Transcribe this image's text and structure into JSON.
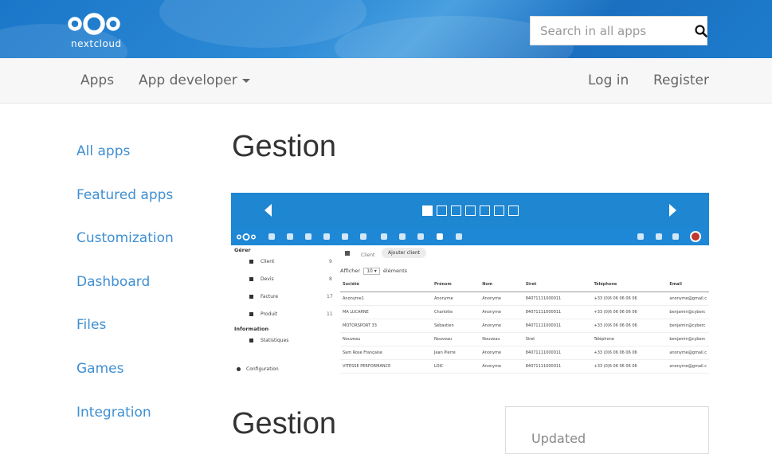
{
  "header": {
    "logo_text": "Nextcloud",
    "search_placeholder": "Search in all apps"
  },
  "nav": {
    "apps": "Apps",
    "app_developer": "App developer",
    "login": "Log in",
    "register": "Register"
  },
  "sidebar": {
    "items": [
      {
        "label": "All apps"
      },
      {
        "label": "Featured apps"
      },
      {
        "label": "Customization"
      },
      {
        "label": "Dashboard"
      },
      {
        "label": "Files"
      },
      {
        "label": "Games"
      },
      {
        "label": "Integration"
      }
    ]
  },
  "main": {
    "title": "Gestion",
    "title_secondary": "Gestion",
    "panel_text": "Updated"
  },
  "carousel": {
    "dot_count": 7,
    "active_index": 0
  },
  "screenshot": {
    "left": {
      "section_manage": "Gérer",
      "items": [
        {
          "label": "Client",
          "count": "9"
        },
        {
          "label": "Devis",
          "count": "8"
        },
        {
          "label": "Facture",
          "count": "17"
        },
        {
          "label": "Produit",
          "count": "11"
        }
      ],
      "section_info": "Information",
      "stats": "Statistiques",
      "config": "Configuration"
    },
    "crumb": "Client",
    "add_client": "Ajouter client",
    "afficher": "Afficher",
    "per_page": "10",
    "elements": "éléments",
    "columns": [
      "Société",
      "Prénom",
      "Nom",
      "Siret",
      "Téléphone",
      "Email"
    ],
    "rows": [
      [
        "Anonyme1",
        "Anonyme",
        "Anonyme",
        "84071111000011",
        "+33 (0)6 06 06 06 06",
        "anonyme@gmail.c"
      ],
      [
        "MA LUCARNE",
        "Charlotte",
        "Anonyme",
        "84071111000011",
        "+33 (0)6 06 06 06 06",
        "benjamin@cyberc"
      ],
      [
        "MOTORSPORT 33",
        "Sébastien",
        "Anonyme",
        "84071111000011",
        "+33 (0)6 06 06 06 06",
        "benjamin@cyberc"
      ],
      [
        "Nouveau",
        "Nouveau",
        "Nouveau",
        "Siret",
        "Téléphone",
        "benjamin@cyberc"
      ],
      [
        "Sam Rose Française",
        "Jean Pierre",
        "Anonyme",
        "84071111000011",
        "+33 (0)6 06 06 06 06",
        "anonyme@gmail.c"
      ],
      [
        "VITESSE PERFORMANCE",
        "LOIC",
        "Anonyme",
        "84071111000011",
        "+33 (0)6 06 06 06 06",
        "anonyme@gmail.c"
      ]
    ]
  }
}
